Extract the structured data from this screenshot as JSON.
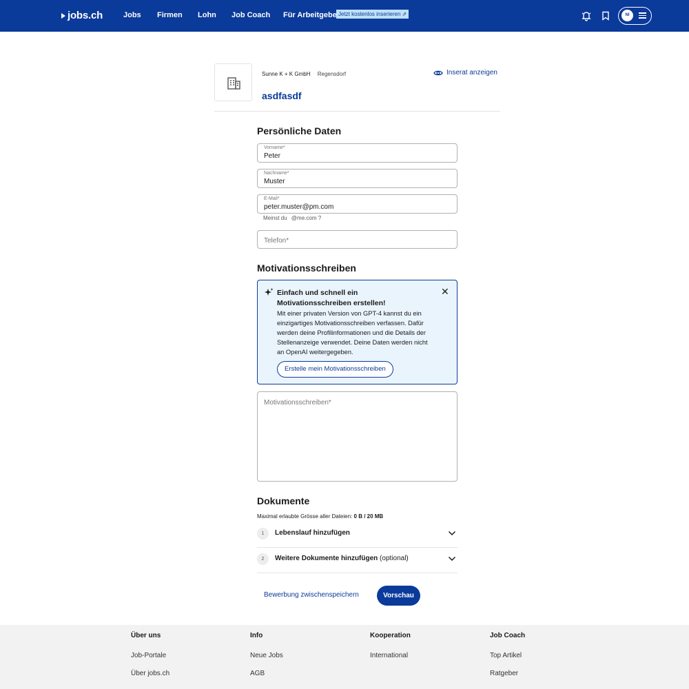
{
  "nav": {
    "logo": "jobs.ch",
    "items": [
      "Jobs",
      "Firmen",
      "Lohn",
      "Job Coach",
      "Für Arbeitgeber"
    ],
    "employer_badge": "Jetzt kostenlos inserieren ⇗",
    "avatar_initials": "NI"
  },
  "job": {
    "company": "Sunne K + K GmbH",
    "location": "Regensdorf",
    "title": "asdfasdf",
    "view_link": "Inserat anzeigen"
  },
  "personal": {
    "heading": "Persönliche Daten",
    "first_name": {
      "label": "Vorname*",
      "value": "Peter"
    },
    "last_name": {
      "label": "Nachname*",
      "value": "Muster"
    },
    "email": {
      "label": "E-Mail*",
      "value": "peter.muster@pm.com"
    },
    "email_hint": "Meinst du",
    "email_suggestion": "@me.com ?",
    "phone": {
      "placeholder": "Telefon*"
    }
  },
  "motivation": {
    "heading": "Motivationsschreiben",
    "ai_title": "Einfach und schnell ein Motivationsschreiben erstellen!",
    "ai_text": "Mit einer privaten Version von GPT-4 kannst du ein einzigartiges Motivationsschreiben verfassen. Dafür werden deine Profilinformationen und die Details der Stellenanzeige verwendet. Deine Daten werden nicht an OpenAI weitergegeben.",
    "ai_button": "Erstelle mein Motivationsschreiben",
    "close": "✕",
    "textarea_placeholder": "Motivationsschreiben*"
  },
  "documents": {
    "heading": "Dokumente",
    "limit_label": "Maximal erlaubte Grösse aller Dateien:",
    "limit_value": "0 B / 20 MB",
    "rows": [
      {
        "num": "1",
        "label": "Lebenslauf hinzufügen",
        "suffix": ""
      },
      {
        "num": "2",
        "label": "Weitere Dokumente hinzufügen",
        "suffix": " (optional)"
      }
    ]
  },
  "actions": {
    "save": "Bewerbung zwischenspeichern",
    "preview": "Vorschau"
  },
  "footer": {
    "columns": [
      {
        "heading": "Über uns",
        "links": [
          "Job-Portale",
          "Über jobs.ch"
        ]
      },
      {
        "heading": "Info",
        "links": [
          "Neue Jobs",
          "AGB"
        ]
      },
      {
        "heading": "Kooperation",
        "links": [
          "International"
        ]
      },
      {
        "heading": "Job Coach",
        "links": [
          "Top Artikel",
          "Ratgeber"
        ]
      }
    ]
  },
  "colors": {
    "primary": "#0a3a9a",
    "ai_background": "#eaf4fc",
    "footer_background": "#f2f2f2"
  }
}
